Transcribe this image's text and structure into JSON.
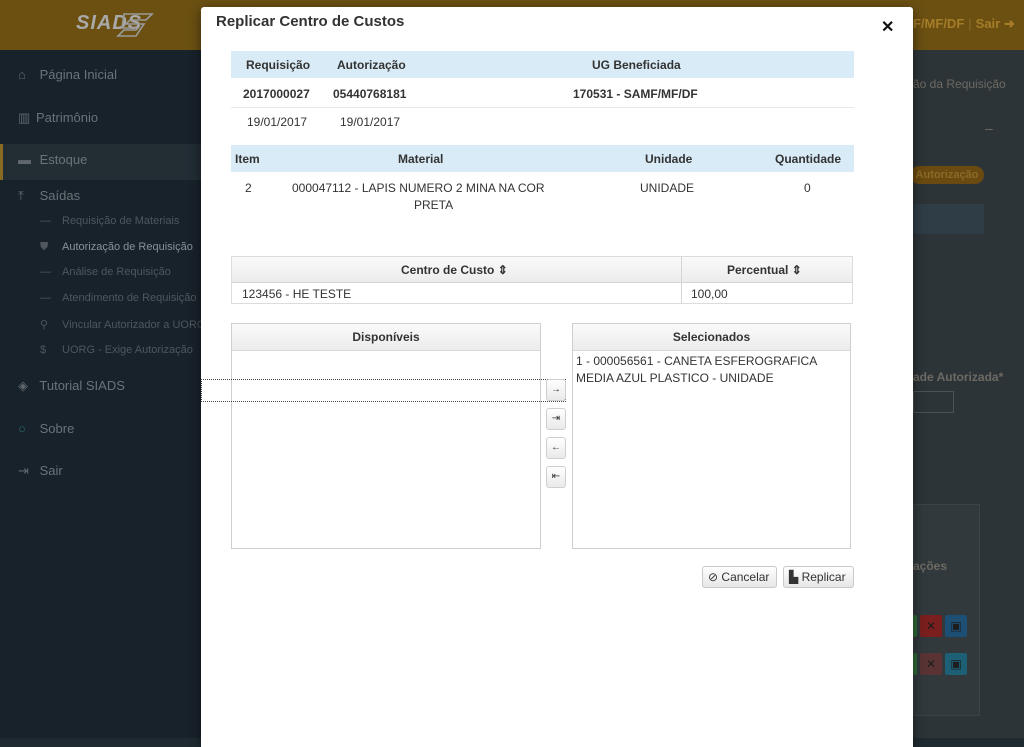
{
  "app": {
    "logo": "SIADS",
    "top_right_org": "F/MF/DF",
    "top_right_exit": "Sair",
    "content_title_fragment": "ão da Requisição",
    "content_badge": "Autorização",
    "content_field_label": "ade Autorizada*",
    "content_panel_label": "ações"
  },
  "sidebar": {
    "items": [
      {
        "label": "Página Inicial",
        "icon": "home-icon"
      },
      {
        "label": "Patrimônio",
        "icon": "barcode-icon"
      },
      {
        "label": "Estoque",
        "icon": "inbox-icon"
      },
      {
        "label": "Saídas",
        "icon": "upload-icon"
      },
      {
        "label": "Tutorial SIADS",
        "icon": "graduation-cap-icon"
      },
      {
        "label": "Sobre",
        "icon": "circle-icon"
      },
      {
        "label": "Sair",
        "icon": "sign-in-icon"
      }
    ],
    "sub_items": [
      {
        "label": "Requisição de Materiais",
        "icon": "minus-icon"
      },
      {
        "label": "Autorização de Requisição",
        "icon": "shield-icon"
      },
      {
        "label": "Análise de Requisição",
        "icon": "minus-icon"
      },
      {
        "label": "Atendimento de Requisição",
        "icon": "minus-icon"
      },
      {
        "label": "Vincular Autorizador a UORG",
        "icon": "link-icon"
      },
      {
        "label": "UORG - Exige Autorização",
        "icon": "dollar-icon"
      }
    ]
  },
  "modal": {
    "title": "Replicar Centro de Custos",
    "close_icon": "close-icon",
    "req_table": {
      "headers": [
        "Requisição",
        "Autorização",
        "UG Beneficiada"
      ],
      "row1": [
        "2017000027",
        "05440768181",
        "170531 - SAMF/MF/DF"
      ],
      "row2": [
        "19/01/2017",
        "19/01/2017"
      ]
    },
    "item_table": {
      "headers": [
        "Item",
        "Material",
        "Unidade",
        "Quantidade"
      ],
      "row": {
        "item": "2",
        "material_line1": "000047112 - LAPIS NUMERO 2 MINA NA COR",
        "material_line2": "PRETA",
        "unidade": "UNIDADE",
        "quantidade": "0"
      }
    },
    "cost_table": {
      "headers": [
        "Centro de Custo",
        "Percentual"
      ],
      "sort_icon": "sort-icon",
      "row": [
        "123456 - HE TESTE",
        "100,00"
      ]
    },
    "available": {
      "title": "Disponíveis",
      "items": []
    },
    "selected": {
      "title": "Selecionados",
      "item_line1": "1 - 000056561 - CANETA ESFEROGRAFICA",
      "item_line2": "MEDIA AZUL PLASTICO - UNIDADE"
    },
    "move_buttons": {
      "move_right": "→",
      "move_all_right": "⇥",
      "move_left": "←",
      "move_all_left": "⇤"
    },
    "buttons": {
      "cancel": "Cancelar",
      "replicate": "Replicar"
    }
  }
}
